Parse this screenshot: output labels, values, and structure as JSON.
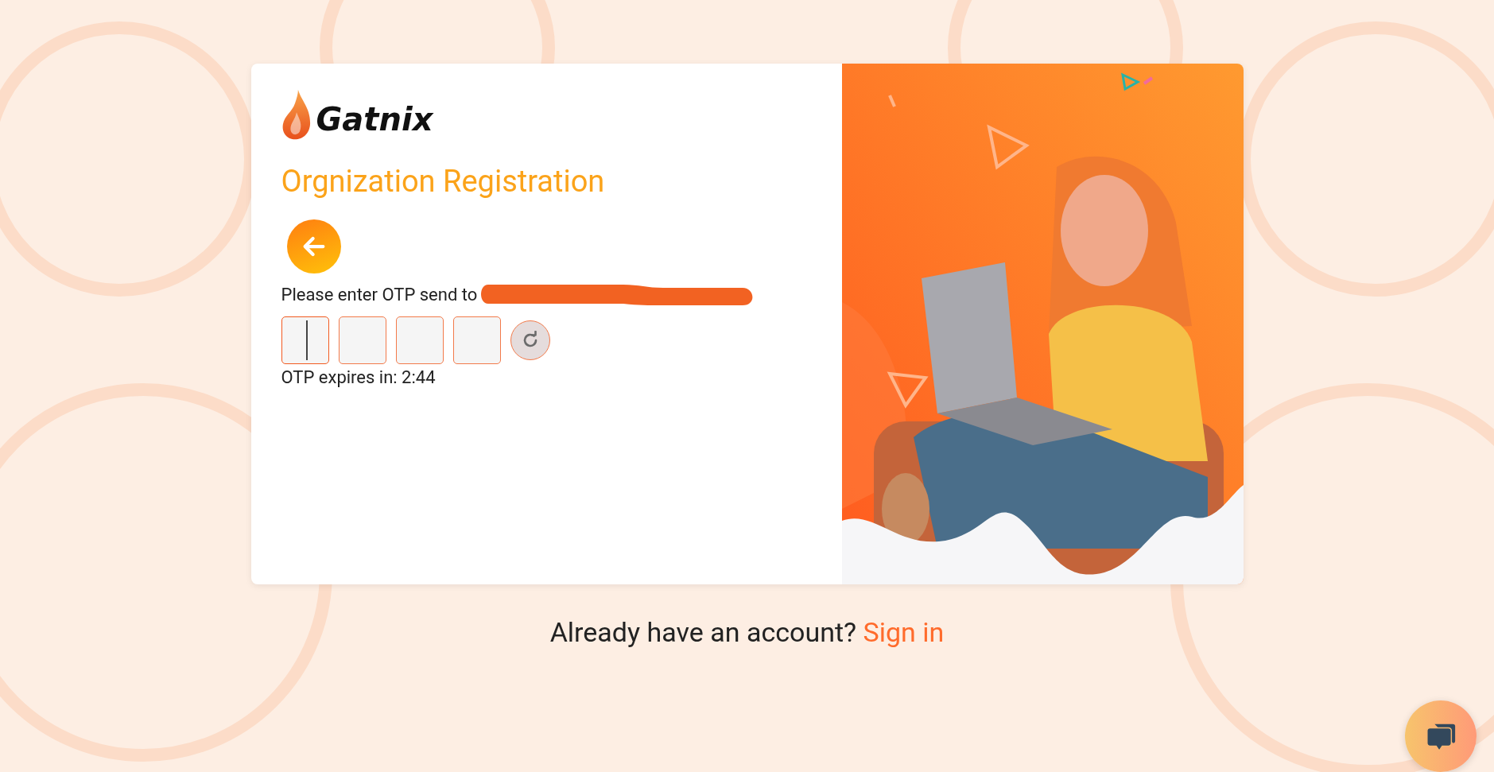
{
  "logo": {
    "text": "Gatnix"
  },
  "title": "Orgnization Registration",
  "prompt": {
    "text": "Please enter OTP send to",
    "redacted": true
  },
  "otp_fields": [
    {
      "focused": true
    },
    {
      "focused": false
    },
    {
      "focused": false
    },
    {
      "focused": false
    }
  ],
  "expiry": "OTP expires in: 2:44",
  "footer": {
    "text": "Already have an account?",
    "link": "Sign in"
  }
}
